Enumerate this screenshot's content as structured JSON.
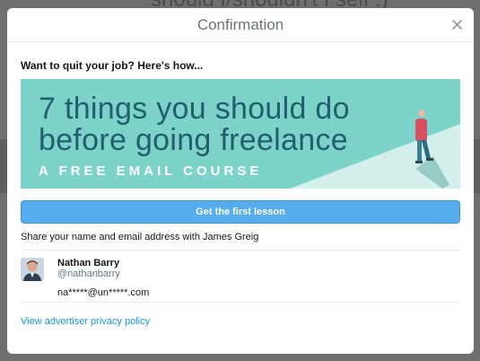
{
  "backdrop": {
    "text": "should I/shouldn't I self :)"
  },
  "modal": {
    "title": "Confirmation",
    "pitch": "Want to quit your job? Here's how...",
    "banner": {
      "line1": "7 things you should do",
      "line2": "before going freelance",
      "subline": "A FREE EMAIL COURSE"
    },
    "cta_label": "Get the first lesson",
    "share_text": "Share your name and email address with James Greig",
    "account": {
      "name": "Nathan Barry",
      "handle": "@nathanbarry",
      "email": "na*****@un*****.com"
    },
    "privacy_link": "View advertiser privacy policy"
  },
  "icons": {
    "close": "close-icon",
    "avatar": "avatar"
  },
  "colors": {
    "accent": "#55acee",
    "banner_bg": "#7dd3c9",
    "banner_text": "#1f5f6e",
    "link": "#1b95e0"
  }
}
